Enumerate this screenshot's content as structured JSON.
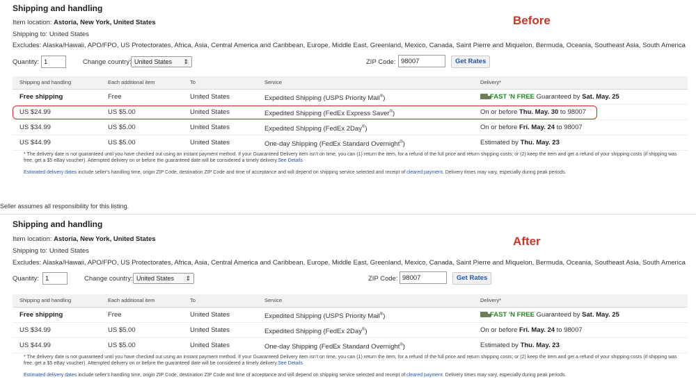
{
  "before": {
    "tag": "Before",
    "title": "Shipping and handling",
    "location_label": "Item location:",
    "location_value": "Astoria, New York, United States",
    "shipping_to": "Shipping to: United States",
    "excludes": "Excludes: Alaska/Hawaii, APO/FPO, US Protectorates, Africa, Asia, Central America and Caribbean, Europe, Middle East, Greenland, Mexico, Canada, Saint Pierre and Miquelon, Bermuda, Oceania, Southeast Asia, South America",
    "quantity_label": "Quantity:",
    "quantity_value": "1",
    "country_label": "Change country:",
    "country_value": "United States",
    "zip_label": "ZIP Code:",
    "zip_value": "98007",
    "get_rates": "Get Rates",
    "headers": [
      "Shipping and handling",
      "Each additional item",
      "To",
      "Service",
      "Delivery*"
    ],
    "rows": [
      {
        "cost": "Free shipping",
        "additional": "Free",
        "to": "United States",
        "service": "Expedited Shipping (USPS Priority Mail",
        "delivery_a": "FAST 'N FREE",
        "delivery_b": " Guaranteed by ",
        "delivery_c": "Sat. May. 25",
        "delivery_d": ""
      },
      {
        "cost": "US $24.99",
        "additional": "US $5.00",
        "to": "United States",
        "service": "Expedited Shipping (FedEx Express Saver",
        "delivery_a": "On or before ",
        "delivery_b": "Thu. May. 30",
        "delivery_c": " to 98007",
        "delivery_d": ""
      },
      {
        "cost": "US $34.99",
        "additional": "US $5.00",
        "to": "United States",
        "service": "Expedited Shipping (FedEx 2Day",
        "delivery_a": "On or before ",
        "delivery_b": "Fri. May. 24",
        "delivery_c": " to 98007",
        "delivery_d": ""
      },
      {
        "cost": "US $44.99",
        "additional": "US $5.00",
        "to": "United States",
        "service": "One-day Shipping (FedEx Standard Overnight",
        "delivery_a": "Estimated by ",
        "delivery_b": "Thu. May. 23",
        "delivery_c": "",
        "delivery_d": ""
      }
    ],
    "note1": "* The delivery date is not guaranteed until you have checked out using an instant payment method. If your Guaranteed Delivery item isn't on time, you can (1) return the item, for a refund of the full price and return shipping costs; or (2) keep the item and get a refund of your shipping costs (if shipping was free, get a $5 eBay voucher). Attempted delivery on or before the guaranteed date will be considered a timely delivery.",
    "see_details": "See Details",
    "note2_link": "Estimated delivery dates",
    "note2_mid": " include seller's handling time, origin ZIP Code, destination ZIP Code and time of acceptance and will depend on shipping service selected and receipt of ",
    "note2_link2": "cleared payment",
    "note2_end": ". Delivery times may vary, especially during peak periods."
  },
  "seller_note": "Seller assumes all responsibility for this listing.",
  "after": {
    "tag": "After",
    "title": "Shipping and handling",
    "location_label": "Item location:",
    "location_value": "Astoria, New York, United States",
    "shipping_to": "Shipping to: United States",
    "excludes": "Excludes: Alaska/Hawaii, APO/FPO, US Protectorates, Africa, Asia, Central America and Caribbean, Europe, Middle East, Greenland, Mexico, Canada, Saint Pierre and Miquelon, Bermuda, Oceania, Southeast Asia, South America",
    "quantity_label": "Quantity:",
    "quantity_value": "1",
    "country_label": "Change country:",
    "country_value": "United States",
    "zip_label": "ZIP Code:",
    "zip_value": "98007",
    "get_rates": "Get Rates",
    "headers": [
      "Shipping and handling",
      "Each additional item",
      "To",
      "Service",
      "Delivery*"
    ],
    "rows": [
      {
        "cost": "Free shipping",
        "additional": "Free",
        "to": "United States",
        "service": "Expedited Shipping (USPS Priority Mail",
        "delivery_a": "FAST 'N FREE",
        "delivery_b": " Guaranteed by ",
        "delivery_c": "Sat. May. 25",
        "delivery_d": ""
      },
      {
        "cost": "US $34.99",
        "additional": "US $5.00",
        "to": "United States",
        "service": "Expedited Shipping (FedEx 2Day",
        "delivery_a": "On or before ",
        "delivery_b": "Fri. May. 24",
        "delivery_c": " to 98007",
        "delivery_d": ""
      },
      {
        "cost": "US $44.99",
        "additional": "US $5.00",
        "to": "United States",
        "service": "One-day Shipping (FedEx Standard Overnight",
        "delivery_a": "Estimated by ",
        "delivery_b": "Thu. May. 23",
        "delivery_c": "",
        "delivery_d": ""
      }
    ],
    "note1": "* The delivery date is not guaranteed until you have checked out using an instant payment method. If your Guaranteed Delivery item isn't on time, you can (1) return the item, for a refund of the full price and return shipping costs; or (2) keep the item and get a refund of your shipping costs (if shipping was free, get a $5 eBay voucher). Attempted delivery on or before the guaranteed date will be considered a timely delivery.",
    "see_details": "See Details",
    "note2_link": "Estimated delivery dates",
    "note2_mid": " include seller's handling time, origin ZIP Code, destination ZIP Code and time of acceptance and will depend on shipping service selected and receipt of ",
    "note2_link2": "cleared payment",
    "note2_end": ". Delivery times may vary, especially during peak periods."
  },
  "registered_mark": "®",
  "closing_paren": ")"
}
